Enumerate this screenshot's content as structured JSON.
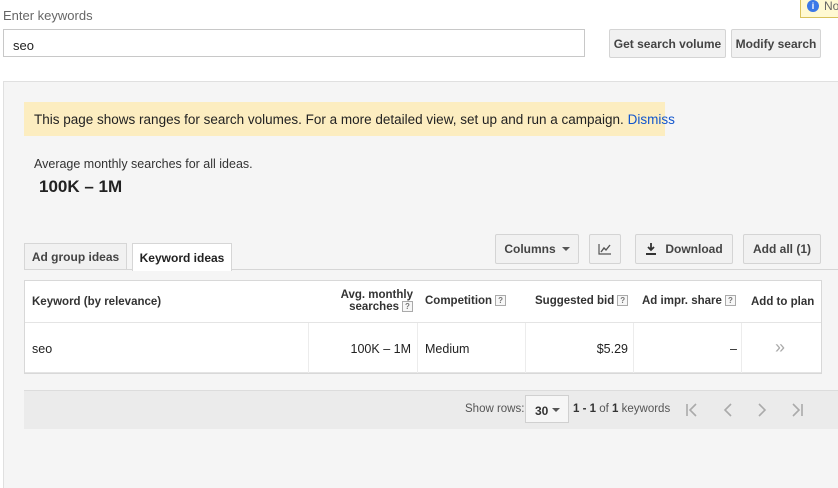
{
  "search": {
    "label": "Enter keywords",
    "value": "seo",
    "get_volume_label": "Get search volume",
    "modify_label": "Modify search"
  },
  "notification": {
    "text": "No"
  },
  "banner": {
    "text": "This page shows ranges for search volumes. For a more detailed view, set up and run a campaign.",
    "dismiss": "Dismiss"
  },
  "summary": {
    "label": "Average monthly searches for all ideas.",
    "value": "100K – 1M"
  },
  "tabs": [
    {
      "label": "Ad group ideas",
      "active": false
    },
    {
      "label": "Keyword ideas",
      "active": true
    }
  ],
  "toolbar": {
    "columns_label": "Columns",
    "download_label": "Download",
    "add_all_label": "Add all (1)"
  },
  "table": {
    "headers": {
      "keyword": "Keyword (by relevance)",
      "avg_line1": "Avg. monthly",
      "avg_line2": "searches",
      "competition": "Competition",
      "bid": "Suggested bid",
      "impr": "Ad impr. share",
      "add": "Add to plan"
    },
    "help_glyph": "?",
    "rows": [
      {
        "keyword": "seo",
        "avg": "100K – 1M",
        "competition": "Medium",
        "bid": "$5.29",
        "impr": "–",
        "add": "»"
      }
    ]
  },
  "pagination": {
    "show_rows_label": "Show rows:",
    "rows_value": "30",
    "range_start": "1",
    "range_sep": " - ",
    "range_end": "1",
    "of": " of ",
    "total": "1",
    "unit": " keywords"
  },
  "colors": {
    "banner_bg": "#fcedc0",
    "link": "#1155cc",
    "panel_bg": "#f5f5f5"
  }
}
